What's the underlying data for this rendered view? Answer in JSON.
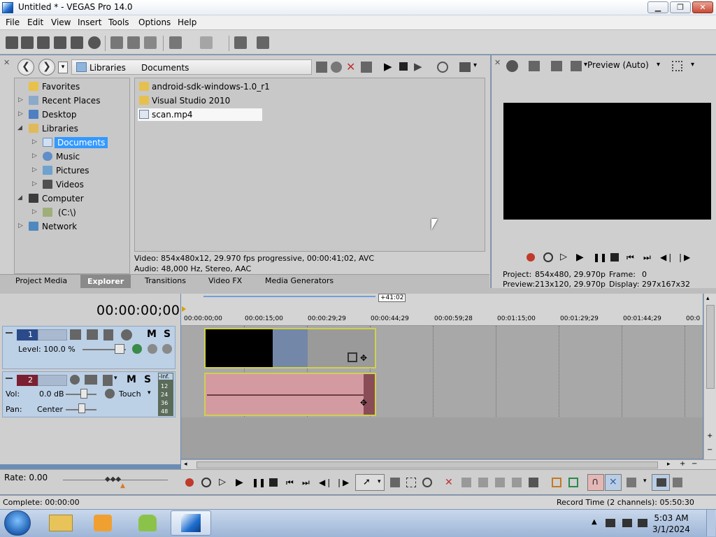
{
  "window": {
    "title": "Untitled * - VEGAS Pro 14.0",
    "min_label": "▁",
    "max_label": "❐",
    "close_label": "✕"
  },
  "menu": [
    "File",
    "Edit",
    "View",
    "Insert",
    "Tools",
    "Options",
    "Help"
  ],
  "explorer": {
    "breadcrumb": [
      "Libraries",
      "Documents"
    ],
    "tree": [
      {
        "label": "Favorites",
        "icon": "star-icon"
      },
      {
        "label": "Recent Places",
        "icon": "recent-icon"
      },
      {
        "label": "Desktop",
        "icon": "desktop-icon"
      },
      {
        "label": "Libraries",
        "icon": "library-icon"
      },
      {
        "label": "Documents",
        "icon": "documents-icon"
      },
      {
        "label": "Music",
        "icon": "music-icon"
      },
      {
        "label": "Pictures",
        "icon": "pictures-icon"
      },
      {
        "label": "Videos",
        "icon": "videos-icon"
      },
      {
        "label": "Computer",
        "icon": "computer-icon"
      },
      {
        "label": "(C:\\)",
        "icon": "drive-icon"
      },
      {
        "label": "Network",
        "icon": "network-icon"
      }
    ],
    "files": [
      {
        "label": "android-sdk-windows-1.0_r1",
        "icon": "folder-icon"
      },
      {
        "label": "Visual Studio 2010",
        "icon": "folder-icon"
      },
      {
        "label": "scan.mp4",
        "icon": "video-file-icon"
      }
    ],
    "info_video": "Video: 854x480x12, 29.970 fps progressive, 00:00:41;02, AVC",
    "info_audio": "Audio: 48,000 Hz, Stereo, AAC",
    "tabs": [
      "Project Media",
      "Explorer",
      "Transitions",
      "Video FX",
      "Media Generators"
    ],
    "active_tab": "Explorer"
  },
  "preview": {
    "mode": "Preview (Auto)",
    "project_label": "Project:",
    "project_value": "854x480, 29.970p",
    "preview_label": "Preview:",
    "preview_value": "213x120, 29.970p",
    "frame_label": "Frame:",
    "frame_value": "0",
    "display_label": "Display:",
    "display_value": "297x167x32"
  },
  "timeline": {
    "timecode": "00:00:00;00",
    "loop_length": "+41:02",
    "ruler": [
      "00:00:00;00",
      "00:00:15;00",
      "00:00:29;29",
      "00:00:44;29",
      "00:00:59;28",
      "00:01:15;00",
      "00:01:29;29",
      "00:01:44;29",
      "00:0"
    ],
    "track1": {
      "number": "1",
      "level_label": "Level: 100.0 %",
      "m": "M",
      "s": "S"
    },
    "track2": {
      "number": "2",
      "vol_label": "Vol:",
      "vol_value": "0.0 dB",
      "pan_label": "Pan:",
      "pan_value": "Center",
      "mode": "Touch",
      "m": "M",
      "s": "S",
      "meter_top": "-Inf.",
      "meter_ticks": [
        "12",
        "24",
        "36",
        "48"
      ]
    }
  },
  "transport": {
    "rate": "Rate: 0.00"
  },
  "status": {
    "left": "Complete: 00:00:00",
    "right": "Record Time (2 channels): 05:50:30"
  },
  "taskbar": {
    "time": "5:03 AM",
    "date": "3/1/2024"
  },
  "colors": {
    "selection": "#3399ff",
    "track_header": "#bcd0e6",
    "clip_border": "#cfd14e",
    "audio_clip": "#d49aa2"
  }
}
